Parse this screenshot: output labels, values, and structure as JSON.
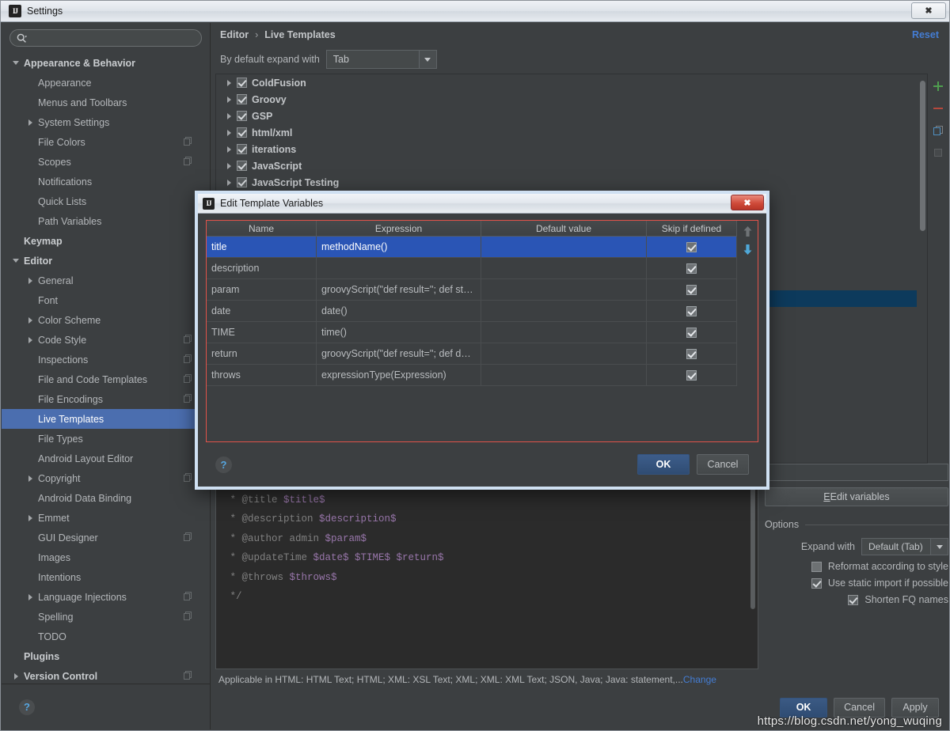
{
  "window": {
    "title": "Settings",
    "icon": "intellij-logo-icon",
    "close_label": "✖"
  },
  "sidebar": {
    "search": {
      "placeholder": "",
      "value": "",
      "icon": "search-icon"
    },
    "items": [
      {
        "label": "Appearance & Behavior",
        "indent": 0,
        "twisty": "down",
        "bold": true,
        "copy": false,
        "selected": false
      },
      {
        "label": "Appearance",
        "indent": 1,
        "twisty": "none",
        "bold": false,
        "copy": false,
        "selected": false
      },
      {
        "label": "Menus and Toolbars",
        "indent": 1,
        "twisty": "none",
        "bold": false,
        "copy": false,
        "selected": false
      },
      {
        "label": "System Settings",
        "indent": 1,
        "twisty": "right",
        "bold": false,
        "copy": false,
        "selected": false
      },
      {
        "label": "File Colors",
        "indent": 1,
        "twisty": "none",
        "bold": false,
        "copy": true,
        "selected": false
      },
      {
        "label": "Scopes",
        "indent": 1,
        "twisty": "none",
        "bold": false,
        "copy": true,
        "selected": false
      },
      {
        "label": "Notifications",
        "indent": 1,
        "twisty": "none",
        "bold": false,
        "copy": false,
        "selected": false
      },
      {
        "label": "Quick Lists",
        "indent": 1,
        "twisty": "none",
        "bold": false,
        "copy": false,
        "selected": false
      },
      {
        "label": "Path Variables",
        "indent": 1,
        "twisty": "none",
        "bold": false,
        "copy": false,
        "selected": false
      },
      {
        "label": "Keymap",
        "indent": 0,
        "twisty": "none",
        "bold": true,
        "copy": false,
        "selected": false
      },
      {
        "label": "Editor",
        "indent": 0,
        "twisty": "down",
        "bold": true,
        "copy": false,
        "selected": false
      },
      {
        "label": "General",
        "indent": 1,
        "twisty": "right",
        "bold": false,
        "copy": false,
        "selected": false
      },
      {
        "label": "Font",
        "indent": 1,
        "twisty": "none",
        "bold": false,
        "copy": false,
        "selected": false
      },
      {
        "label": "Color Scheme",
        "indent": 1,
        "twisty": "right",
        "bold": false,
        "copy": false,
        "selected": false
      },
      {
        "label": "Code Style",
        "indent": 1,
        "twisty": "right",
        "bold": false,
        "copy": true,
        "selected": false
      },
      {
        "label": "Inspections",
        "indent": 1,
        "twisty": "none",
        "bold": false,
        "copy": true,
        "selected": false
      },
      {
        "label": "File and Code Templates",
        "indent": 1,
        "twisty": "none",
        "bold": false,
        "copy": true,
        "selected": false
      },
      {
        "label": "File Encodings",
        "indent": 1,
        "twisty": "none",
        "bold": false,
        "copy": true,
        "selected": false
      },
      {
        "label": "Live Templates",
        "indent": 1,
        "twisty": "none",
        "bold": false,
        "copy": false,
        "selected": true
      },
      {
        "label": "File Types",
        "indent": 1,
        "twisty": "none",
        "bold": false,
        "copy": false,
        "selected": false
      },
      {
        "label": "Android Layout Editor",
        "indent": 1,
        "twisty": "none",
        "bold": false,
        "copy": false,
        "selected": false
      },
      {
        "label": "Copyright",
        "indent": 1,
        "twisty": "right",
        "bold": false,
        "copy": true,
        "selected": false
      },
      {
        "label": "Android Data Binding",
        "indent": 1,
        "twisty": "none",
        "bold": false,
        "copy": false,
        "selected": false
      },
      {
        "label": "Emmet",
        "indent": 1,
        "twisty": "right",
        "bold": false,
        "copy": false,
        "selected": false
      },
      {
        "label": "GUI Designer",
        "indent": 1,
        "twisty": "none",
        "bold": false,
        "copy": true,
        "selected": false
      },
      {
        "label": "Images",
        "indent": 1,
        "twisty": "none",
        "bold": false,
        "copy": false,
        "selected": false
      },
      {
        "label": "Intentions",
        "indent": 1,
        "twisty": "none",
        "bold": false,
        "copy": false,
        "selected": false
      },
      {
        "label": "Language Injections",
        "indent": 1,
        "twisty": "right",
        "bold": false,
        "copy": true,
        "selected": false
      },
      {
        "label": "Spelling",
        "indent": 1,
        "twisty": "none",
        "bold": false,
        "copy": true,
        "selected": false
      },
      {
        "label": "TODO",
        "indent": 1,
        "twisty": "none",
        "bold": false,
        "copy": false,
        "selected": false
      },
      {
        "label": "Plugins",
        "indent": 0,
        "twisty": "none",
        "bold": true,
        "copy": false,
        "selected": false
      },
      {
        "label": "Version Control",
        "indent": 0,
        "twisty": "right",
        "bold": true,
        "copy": true,
        "selected": false
      }
    ],
    "help_label": "?"
  },
  "main": {
    "breadcrumb": {
      "root": "Editor",
      "separator": "›",
      "leaf": "Live Templates"
    },
    "reset_label": "Reset",
    "expand_with": {
      "label": "By default expand with",
      "value": "Tab"
    },
    "templates": [
      {
        "label": "ColdFusion",
        "checked": true,
        "selected": false
      },
      {
        "label": "Groovy",
        "checked": true,
        "selected": false
      },
      {
        "label": "GSP",
        "checked": true,
        "selected": false
      },
      {
        "label": "html/xml",
        "checked": true,
        "selected": false
      },
      {
        "label": "iterations",
        "checked": true,
        "selected": false
      },
      {
        "label": "JavaScript",
        "checked": true,
        "selected": false
      },
      {
        "label": "JavaScript Testing",
        "checked": true,
        "selected": false
      }
    ],
    "toolbar": [
      {
        "name": "add-template-button",
        "glyph": "+",
        "color": "#4f9e4f"
      },
      {
        "name": "remove-template-button",
        "glyph": "−",
        "color": "#b5483d"
      },
      {
        "name": "duplicate-template-button",
        "glyph": "copy",
        "color": "#4f8fc0"
      },
      {
        "name": "restore-defaults-button",
        "glyph": "square",
        "color": "#5a5d5f"
      }
    ],
    "code": [
      {
        "text": "/**",
        "kind": "plain"
      },
      {
        "pre": " * @title ",
        "var": "$title$"
      },
      {
        "pre": " * @description ",
        "var": "$description$"
      },
      {
        "pre": " * @author admin ",
        "var": "$param$"
      },
      {
        "pre": " * @updateTime ",
        "var": "$date$ $TIME$ $return$"
      },
      {
        "pre": " * @throws ",
        "var": "$throws$"
      },
      {
        "text": " */",
        "kind": "plain"
      }
    ],
    "applicable": {
      "text": "Applicable in HTML: HTML Text; HTML; XML: XSL Text; XML; XML: XML Text; JSON, Java; Java: statement,...",
      "change_label": "Change"
    },
    "options": {
      "edit_variables_label": "Edit variables",
      "section_title": "Options",
      "expand_with_label": "Expand with",
      "expand_with_value": "Default (Tab)",
      "checks": [
        {
          "label": "Reformat according to style",
          "checked": false
        },
        {
          "label": "Use static import if possible",
          "checked": true
        },
        {
          "label": "Shorten FQ names",
          "checked": true
        }
      ]
    },
    "footer": {
      "ok": "OK",
      "cancel": "Cancel",
      "apply": "Apply"
    },
    "watermark": "https://blog.csdn.net/yong_wuqing"
  },
  "dialog": {
    "title": "Edit Template Variables",
    "icon": "intellij-logo-icon",
    "close_label": "✖",
    "columns": [
      "Name",
      "Expression",
      "Default value",
      "Skip if defined"
    ],
    "rows": [
      {
        "name": "title",
        "expression": "methodName()",
        "default": "",
        "skip": true,
        "selected": true
      },
      {
        "name": "description",
        "expression": "",
        "default": "",
        "skip": true,
        "selected": false
      },
      {
        "name": "param",
        "expression": "groovyScript(\"def result=''; def st…",
        "default": "",
        "skip": true,
        "selected": false
      },
      {
        "name": "date",
        "expression": "date()",
        "default": "",
        "skip": true,
        "selected": false
      },
      {
        "name": "TIME",
        "expression": "time()",
        "default": "",
        "skip": true,
        "selected": false
      },
      {
        "name": "return",
        "expression": "groovyScript(\"def result=''; def d…",
        "default": "",
        "skip": true,
        "selected": false
      },
      {
        "name": "throws",
        "expression": "expressionType(Expression)",
        "default": "",
        "skip": true,
        "selected": false
      }
    ],
    "move_up_icon": "arrow-up-icon",
    "move_down_icon": "arrow-down-icon",
    "help_label": "?",
    "ok": "OK",
    "cancel": "Cancel"
  }
}
